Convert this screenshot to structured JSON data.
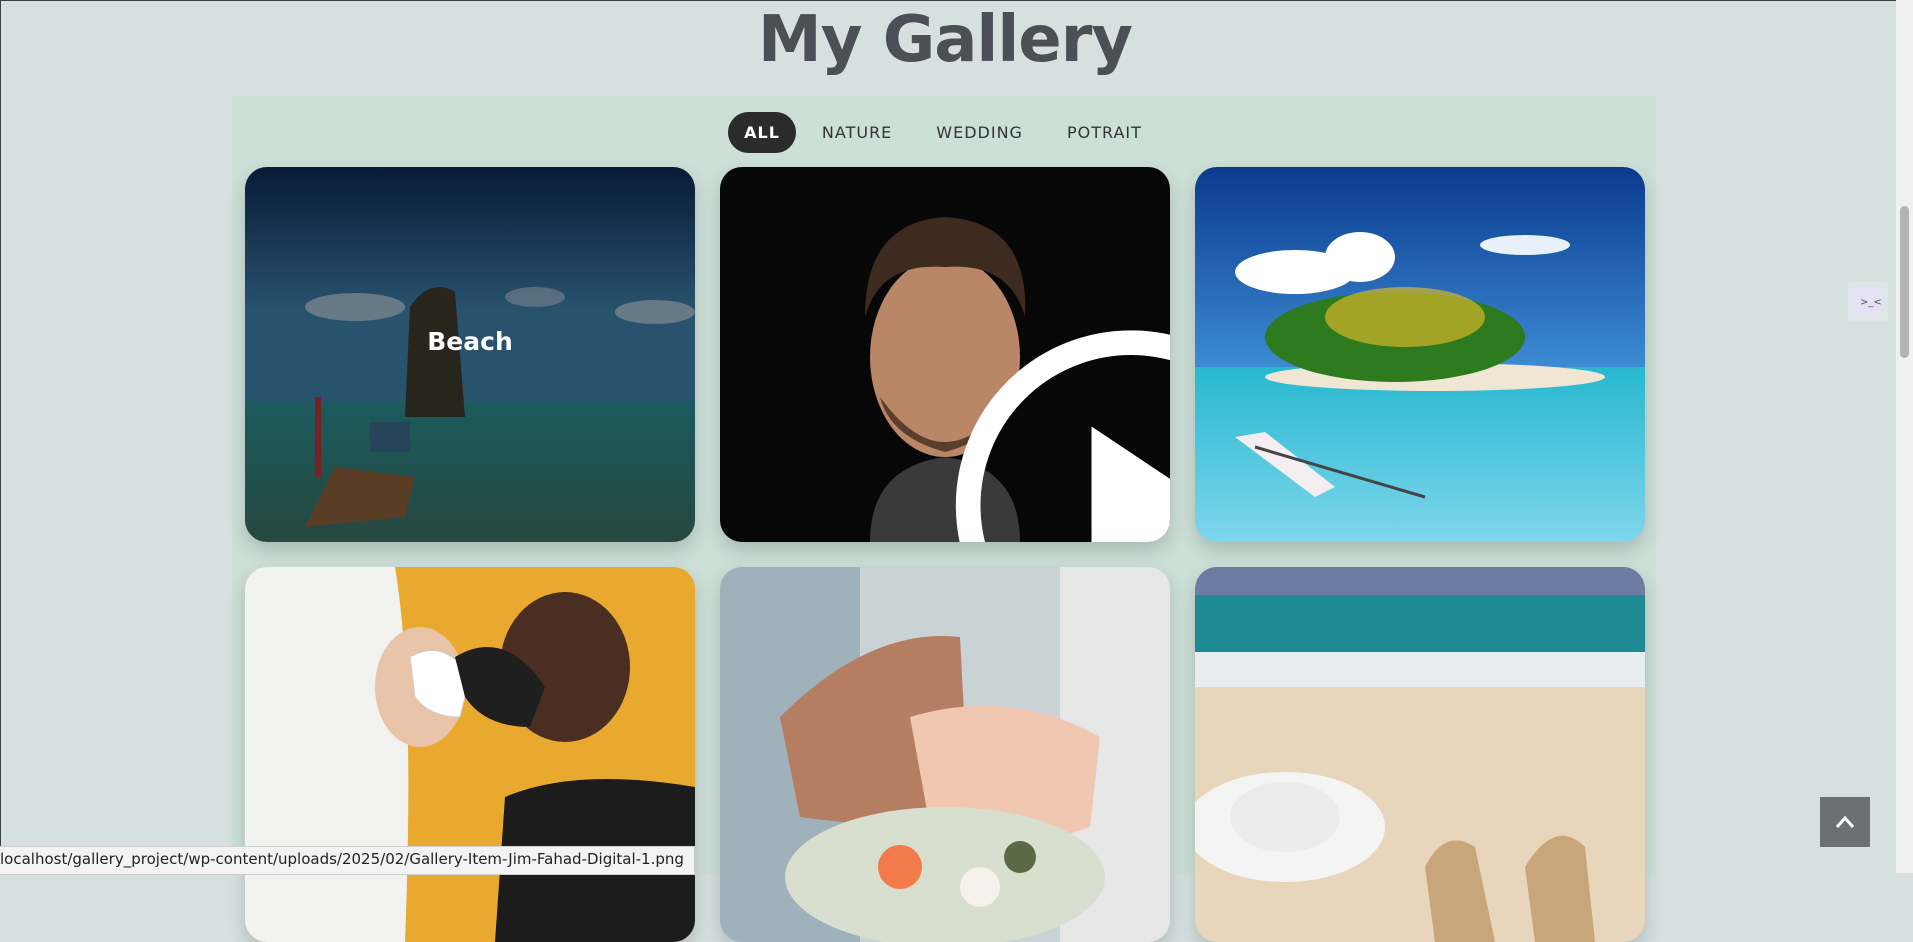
{
  "gallery": {
    "title": "My Gallery",
    "filters": [
      "ALL",
      "NATURE",
      "WEDDING",
      "POTRAIT"
    ],
    "active_filter": "ALL",
    "items": [
      {
        "label": "Beach",
        "category": "NATURE"
      },
      {
        "label": "",
        "category": "POTRAIT"
      },
      {
        "label": "",
        "category": "NATURE"
      },
      {
        "label": "",
        "category": "WEDDING"
      },
      {
        "label": "",
        "category": "WEDDING"
      },
      {
        "label": "",
        "category": "NATURE"
      }
    ]
  },
  "status_bar": {
    "url": "localhost/gallery_project/wp-content/uploads/2025/02/Gallery-Item-Jim-Fahad-Digital-1.png"
  },
  "icons": {
    "play": "play-icon",
    "back_to_top": "chevron-up-icon",
    "side_widget": "chat-bot-icon"
  },
  "colors": {
    "page_bg": "#d6e1df",
    "gallery_bg": "#cde0d8",
    "active_filter_bg": "#2b2b2b",
    "title": "#4a5056"
  }
}
